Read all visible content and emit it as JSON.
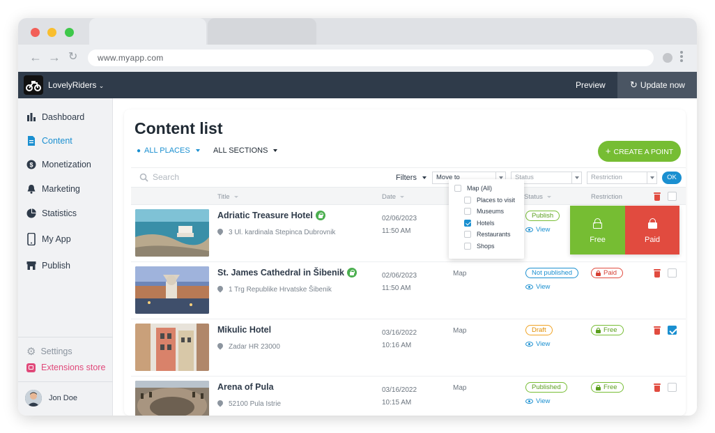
{
  "browser": {
    "url": "www.myapp.com"
  },
  "header": {
    "brand": "LovelyRiders",
    "preview_label": "Preview",
    "update_label": "Update now"
  },
  "sidebar": {
    "items": [
      {
        "label": "Dashboard",
        "icon": "bar-chart-icon"
      },
      {
        "label": "Content",
        "icon": "document-icon"
      },
      {
        "label": "Monetization",
        "icon": "dollar-icon"
      },
      {
        "label": "Marketing",
        "icon": "bell-icon"
      },
      {
        "label": "Statistics",
        "icon": "pie-chart-icon"
      },
      {
        "label": "My App",
        "icon": "phone-icon"
      },
      {
        "label": "Publish",
        "icon": "store-icon"
      }
    ],
    "settings_label": "Settings",
    "extensions_label": "Extensions store",
    "user_name": "Jon Doe"
  },
  "main": {
    "title": "Content list",
    "places_filter": "ALL PLACES",
    "sections_filter": "ALL SECTIONS",
    "create_label": "CREATE A POINT",
    "search_placeholder": "Search",
    "filters_label": "Filters",
    "move_to_label": "Move to",
    "status_select": "Status",
    "restriction_select": "Restriction",
    "ok_label": "OK",
    "columns": {
      "title": "Title",
      "date": "Date",
      "status": "Status",
      "restriction": "Restriction"
    },
    "move_dropdown": [
      {
        "label": "Map (All)",
        "checked": false
      },
      {
        "label": "Places to visit",
        "checked": false
      },
      {
        "label": "Museums",
        "checked": false
      },
      {
        "label": "Hotels",
        "checked": true
      },
      {
        "label": "Restaurants",
        "checked": false
      },
      {
        "label": "Shops",
        "checked": false
      }
    ],
    "restriction_overlay": {
      "free_label": "Free",
      "paid_label": "Paid"
    },
    "rows": [
      {
        "title": "Adriatic Treasure Hotel",
        "address": "3 Ul. kardinala Stepinca Dubrovnik",
        "date": "02/06/2023",
        "time": "11:50 AM",
        "type": "",
        "status": "Publish",
        "view": "View",
        "restriction": "",
        "checked": true
      },
      {
        "title": "St. James Cathedral in Šibenik",
        "address": "1 Trg Republike Hrvatske Šibenik",
        "date": "02/06/2023",
        "time": "11:50 AM",
        "type": "Map",
        "status": "Not published",
        "view": "View",
        "restriction": "Paid",
        "checked": false
      },
      {
        "title": "Mikulic Hotel",
        "address": "Zadar HR 23000",
        "date": "03/16/2022",
        "time": "10:16 AM",
        "type": "Map",
        "status": "Draft",
        "view": "View",
        "restriction": "Free",
        "checked": true
      },
      {
        "title": "Arena of Pula",
        "address": "52100 Pula Istrie",
        "date": "03/16/2022",
        "time": "10:15 AM",
        "type": "Map",
        "status": "Published",
        "view": "View",
        "restriction": "Free",
        "checked": false
      }
    ]
  },
  "colors": {
    "header_bg": "#2f3b4a",
    "accent_blue": "#1a8fd0",
    "accent_green": "#76bd33",
    "accent_red": "#e14b3f",
    "extensions_pink": "#e0497a"
  }
}
